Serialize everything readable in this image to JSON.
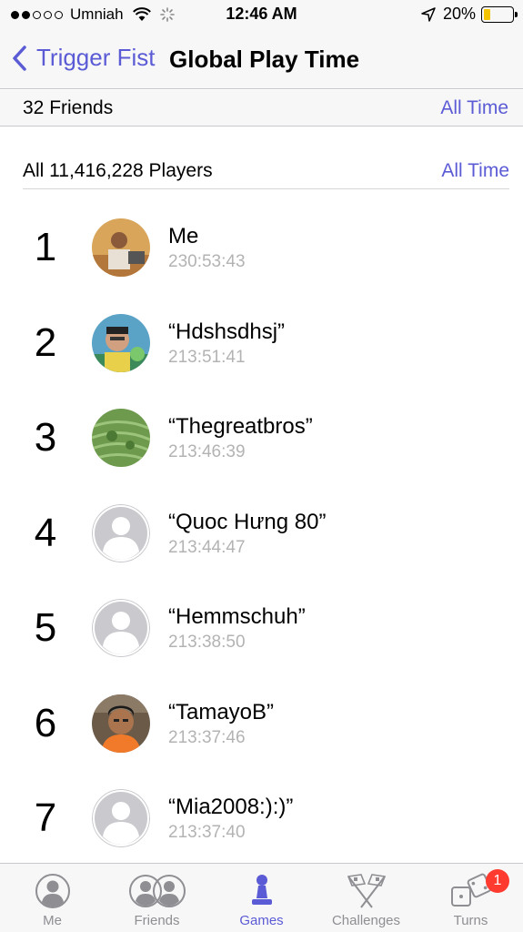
{
  "status_bar": {
    "carrier": "Umniah",
    "time": "12:46 AM",
    "battery": "20%",
    "battery_level": 0.2,
    "signal_bars": 2
  },
  "nav": {
    "back_label": "Trigger Fist",
    "title": "Global Play Time"
  },
  "friends_section": {
    "label": "32 Friends",
    "filter": "All Time"
  },
  "players_section": {
    "label": "All 11,416,228 Players",
    "filter": "All Time"
  },
  "leaderboard": [
    {
      "rank": "1",
      "name": "Me",
      "time": "230:53:43",
      "avatar": "photo"
    },
    {
      "rank": "2",
      "name": "“Hdshsdhsj”",
      "time": "213:51:41",
      "avatar": "photo"
    },
    {
      "rank": "3",
      "name": "“Thegreatbros”",
      "time": "213:46:39",
      "avatar": "photo"
    },
    {
      "rank": "4",
      "name": "“Quoc Hưng 80”",
      "time": "213:44:47",
      "avatar": "placeholder"
    },
    {
      "rank": "5",
      "name": "“Hemmschuh”",
      "time": "213:38:50",
      "avatar": "placeholder"
    },
    {
      "rank": "6",
      "name": "“TamayoB”",
      "time": "213:37:46",
      "avatar": "photo"
    },
    {
      "rank": "7",
      "name": "“Mia2008:):)”",
      "time": "213:37:40",
      "avatar": "placeholder"
    }
  ],
  "tabs": [
    {
      "label": "Me",
      "icon": "person-icon"
    },
    {
      "label": "Friends",
      "icon": "friends-icon"
    },
    {
      "label": "Games",
      "icon": "game-piece-icon",
      "active": true
    },
    {
      "label": "Challenges",
      "icon": "crossed-flags-icon"
    },
    {
      "label": "Turns",
      "icon": "dice-icon",
      "badge": "1"
    }
  ],
  "colors": {
    "accent": "#5b5bd6",
    "secondary_text": "#b3b3b3",
    "badge": "#ff3b30",
    "battery": "#f5c400"
  }
}
